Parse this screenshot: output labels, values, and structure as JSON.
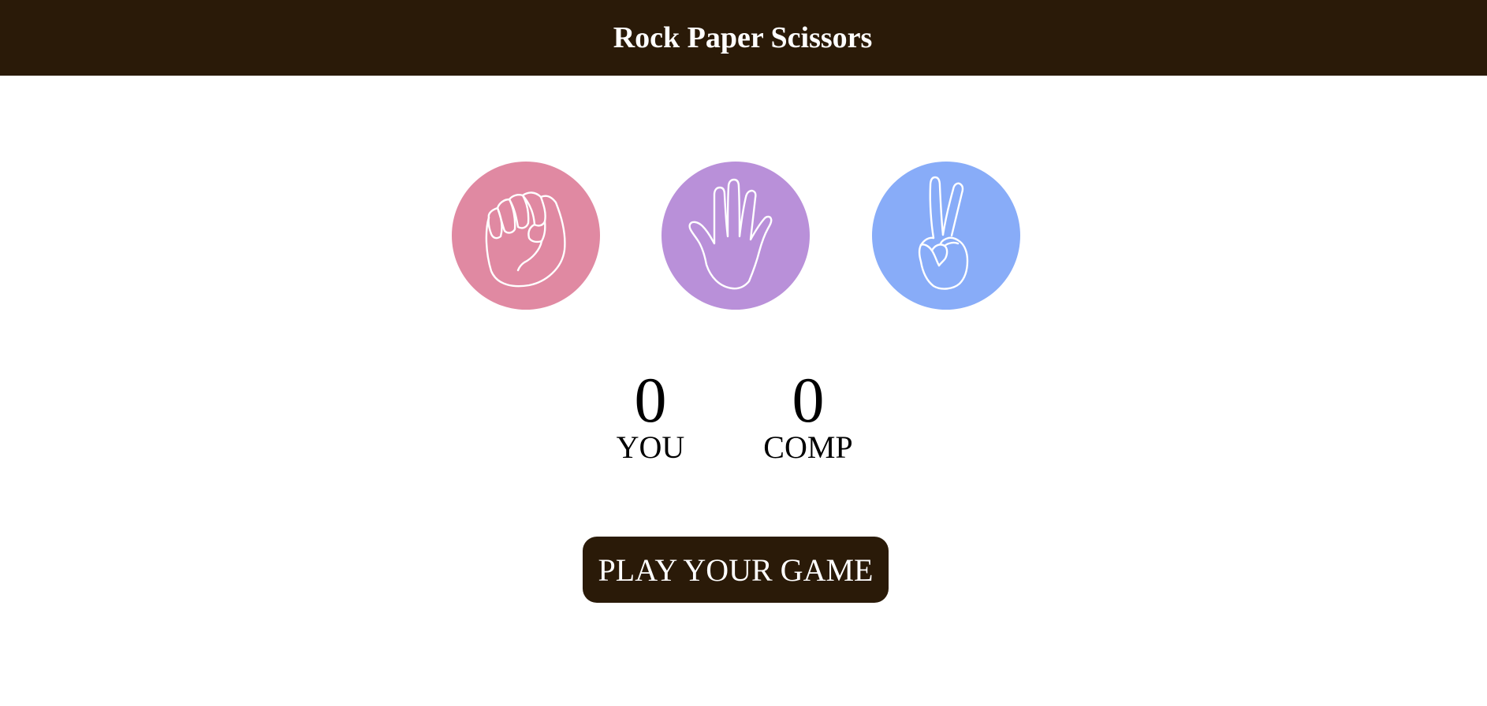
{
  "header": {
    "title": "Rock Paper Scissors"
  },
  "choices": [
    {
      "name": "rock",
      "icon": "fist-icon",
      "color": "#e089a2"
    },
    {
      "name": "paper",
      "icon": "open-hand-icon",
      "color": "#b990d9"
    },
    {
      "name": "scissors",
      "icon": "peace-hand-icon",
      "color": "#88acf8"
    }
  ],
  "scores": {
    "you": {
      "value": "0",
      "label": "YOU"
    },
    "comp": {
      "value": "0",
      "label": "COMP"
    }
  },
  "actions": {
    "play_label": "PLAY YOUR GAME"
  },
  "colors": {
    "header_bg": "#2a1a08",
    "button_bg": "#2a1a08",
    "text_light": "#ffffff"
  }
}
